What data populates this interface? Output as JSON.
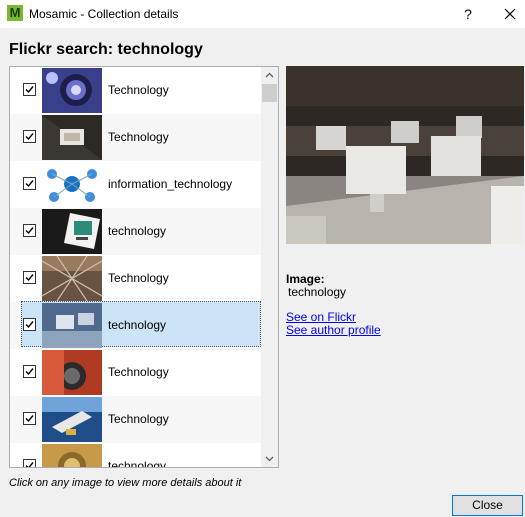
{
  "window": {
    "title": "Mosamic - Collection details",
    "icon_letter": "M",
    "help": "?"
  },
  "heading": "Flickr search: technology",
  "items": [
    {
      "label": "Technology",
      "checked": true
    },
    {
      "label": "Technology",
      "checked": true
    },
    {
      "label": "information_technology",
      "checked": true
    },
    {
      "label": "technology",
      "checked": true
    },
    {
      "label": "Technology",
      "checked": true
    },
    {
      "label": "technology",
      "checked": true,
      "selected": true
    },
    {
      "label": "Technology",
      "checked": true
    },
    {
      "label": "Technology",
      "checked": true
    },
    {
      "label": "technology",
      "checked": true
    }
  ],
  "details": {
    "image_label": "Image:",
    "image_value": "technology",
    "link_flickr": "See on Flickr",
    "link_author": "See author profile"
  },
  "hint": "Click on any image to view more details about it",
  "close_label": "Close"
}
